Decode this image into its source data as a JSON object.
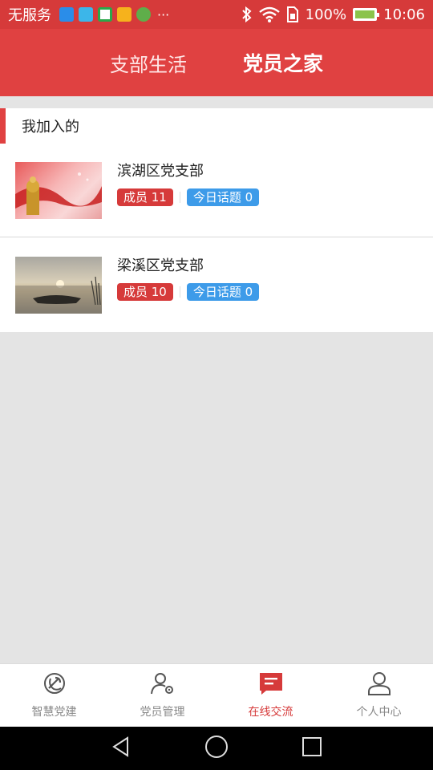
{
  "status_bar": {
    "carrier": "无服务",
    "battery_text": "100%",
    "time": "10:06",
    "more": "···"
  },
  "header": {
    "tabs": [
      {
        "label": "支部生活",
        "active": false
      },
      {
        "label": "党员之家",
        "active": true
      }
    ]
  },
  "section": {
    "title": "我加入的",
    "groups": [
      {
        "name": "滨湖区党支部",
        "members_label": "成员 11",
        "topics_label": "今日话题 0"
      },
      {
        "name": "梁溪区党支部",
        "members_label": "成员 10",
        "topics_label": "今日话题 0"
      }
    ]
  },
  "bottom_nav": {
    "items": [
      {
        "label": "智慧党建",
        "icon": "party-emblem-icon"
      },
      {
        "label": "党员管理",
        "icon": "user-gear-icon"
      },
      {
        "label": "在线交流",
        "icon": "chat-icon",
        "active": true
      },
      {
        "label": "个人中心",
        "icon": "person-icon"
      }
    ]
  },
  "colors": {
    "primary": "#e04141",
    "status_bar": "#d63a3a",
    "badge_red": "#d63a3a",
    "badge_blue": "#3d9be9"
  }
}
